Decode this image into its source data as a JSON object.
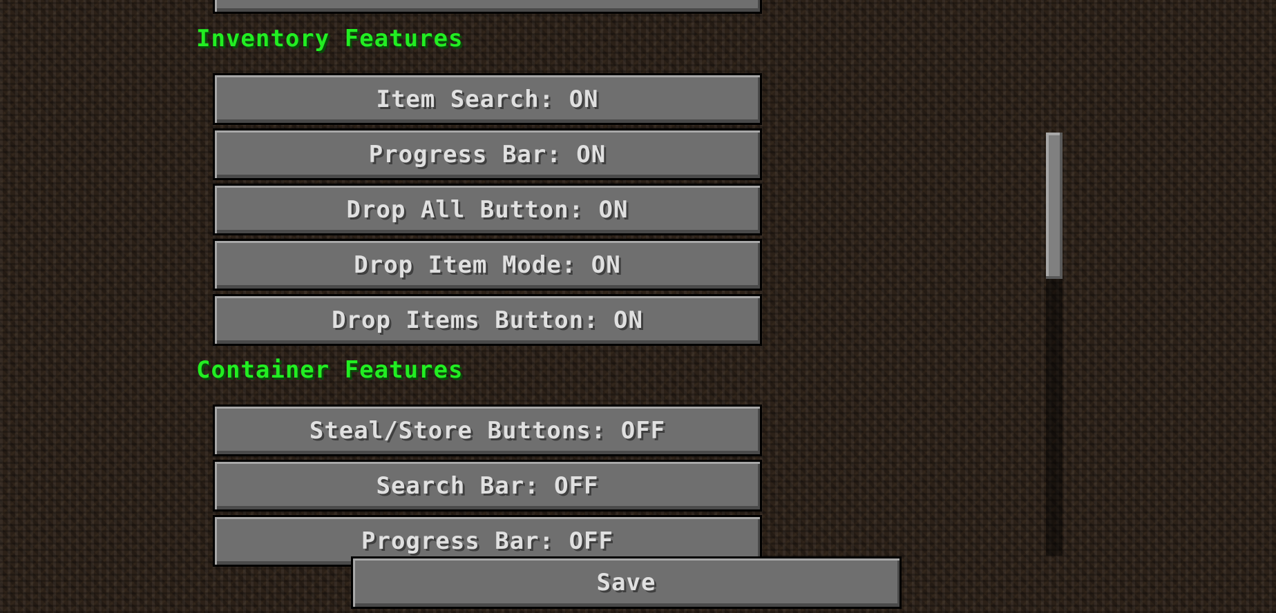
{
  "sections": {
    "inventory": {
      "title": "Inventory Features",
      "options": [
        {
          "label": "Item Search: ON"
        },
        {
          "label": "Progress Bar: ON"
        },
        {
          "label": "Drop All Button: ON"
        },
        {
          "label": "Drop Item Mode: ON"
        },
        {
          "label": "Drop Items Button: ON"
        }
      ]
    },
    "container": {
      "title": "Container Features",
      "options": [
        {
          "label": "Steal/Store Buttons: OFF"
        },
        {
          "label": "Search Bar: OFF"
        },
        {
          "label": "Progress Bar: OFF"
        }
      ]
    }
  },
  "footer": {
    "save_label": "Save"
  },
  "colors": {
    "heading": "#22ee22",
    "button_face": "#6f6f6f",
    "button_text": "#e0e0e0"
  }
}
